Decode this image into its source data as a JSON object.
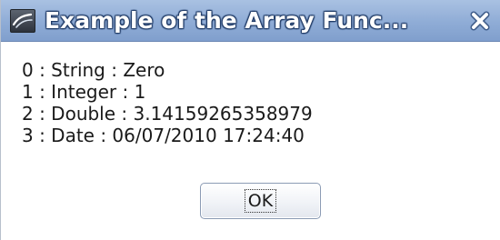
{
  "window": {
    "title": "Example of the Array Func...",
    "app_icon": "office-app-icon",
    "close_icon": "close-x-icon"
  },
  "message": {
    "lines": [
      "0 : String : Zero",
      "1 : Integer : 1",
      "2 : Double : 3.14159265358979",
      "3 : Date : 06/07/2010 17:24:40"
    ]
  },
  "buttons": {
    "ok_label": "OK"
  },
  "colors": {
    "titlebar": "#8facd6",
    "titlebar_text": "#ffffff",
    "body_text": "#1a1a1a",
    "button_border": "#8b9bb4"
  }
}
